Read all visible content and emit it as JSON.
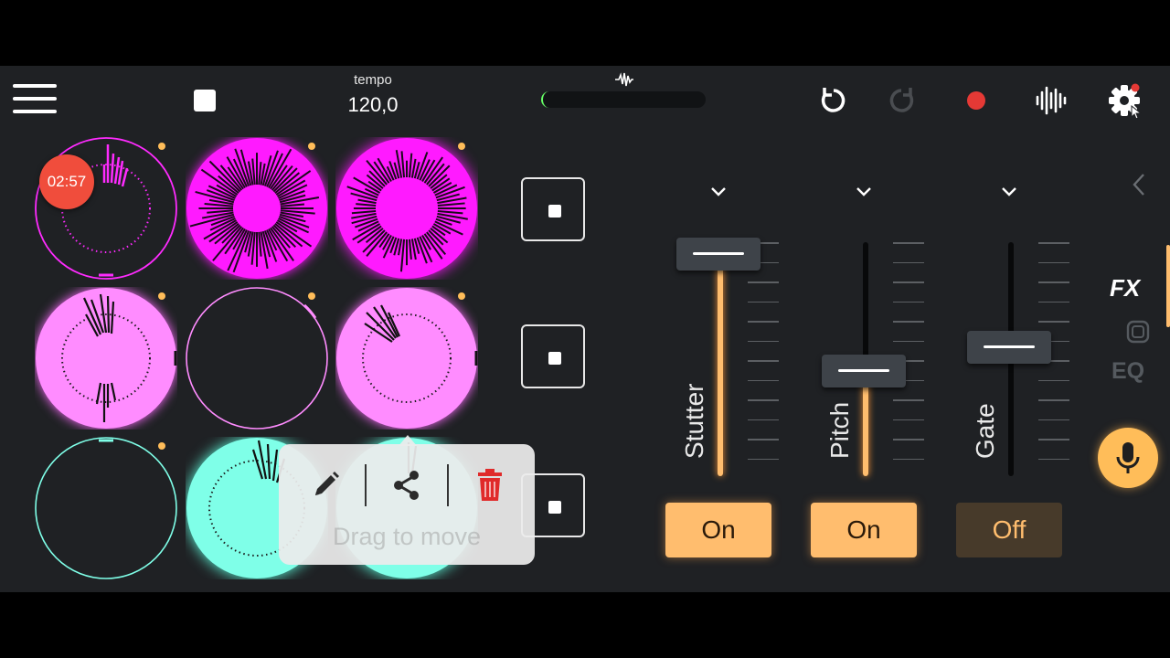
{
  "toolbar": {
    "tempo_label": "tempo",
    "tempo_value": "120,0",
    "icons": [
      "menu-icon",
      "stop-icon",
      "waveform-icon",
      "undo-icon",
      "redo-icon",
      "record-icon",
      "audio-bars-icon",
      "settings-icon"
    ]
  },
  "pads": {
    "timer": "02:57"
  },
  "popup": {
    "hint": "Drag to move",
    "icons": [
      "edit-icon",
      "share-icon",
      "delete-icon"
    ]
  },
  "fx": {
    "faders": [
      {
        "name": "Stutter",
        "toggle": "On",
        "level": 0.95
      },
      {
        "name": "Pitch",
        "toggle": "On",
        "level": 0.45
      },
      {
        "name": "Gate",
        "toggle": "Off",
        "level": 0.55
      }
    ]
  },
  "sidebar": {
    "fx_label": "FX",
    "eq_label": "EQ"
  },
  "colors": {
    "accent": "#ffbd6e",
    "magenta": "#ff1aff",
    "pink": "#ff8cff",
    "cyan": "#7fffe8",
    "background": "#1f2124",
    "record": "#e53935",
    "timer_badge": "#f04d3c"
  }
}
